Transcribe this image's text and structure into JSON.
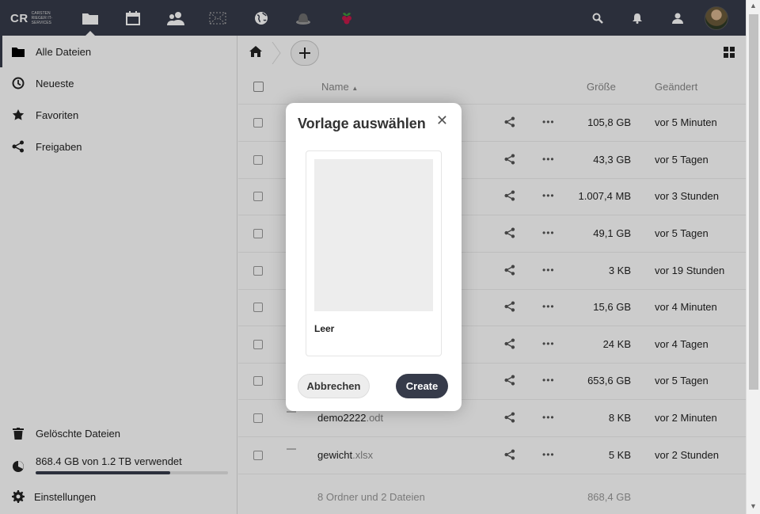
{
  "header": {
    "logo_text": "CR",
    "logo_subtitle": "Carsten Rieger IT-Services"
  },
  "sidebar": {
    "items": [
      {
        "label": "Alle Dateien",
        "icon": "folder-icon"
      },
      {
        "label": "Neueste",
        "icon": "clock-icon"
      },
      {
        "label": "Favoriten",
        "icon": "star-icon"
      },
      {
        "label": "Freigaben",
        "icon": "share-icon"
      }
    ],
    "deleted_label": "Gelöschte Dateien",
    "quota_label": "868.4 GB von 1.2 TB verwendet",
    "quota_fraction": 0.7,
    "settings_label": "Einstellungen"
  },
  "table": {
    "col_name": "Name",
    "col_size": "Größe",
    "col_modified": "Geändert",
    "rows": [
      {
        "name": "",
        "ext": "",
        "size": "105,8 GB",
        "modified": "vor 5 Minuten"
      },
      {
        "name": "",
        "ext": "",
        "size": "43,3 GB",
        "modified": "vor 5 Tagen"
      },
      {
        "name": "",
        "ext": "",
        "size": "1.007,4 MB",
        "modified": "vor 3 Stunden"
      },
      {
        "name": "",
        "ext": "",
        "size": "49,1 GB",
        "modified": "vor 5 Tagen"
      },
      {
        "name": "",
        "ext": "",
        "size": "3 KB",
        "modified": "vor 19 Stunden"
      },
      {
        "name": "",
        "ext": "",
        "size": "15,6 GB",
        "modified": "vor 4 Minuten"
      },
      {
        "name": "",
        "ext": "",
        "size": "24 KB",
        "modified": "vor 4 Tagen"
      },
      {
        "name": "",
        "ext": "",
        "size": "653,6 GB",
        "modified": "vor 5 Tagen"
      },
      {
        "name": "demo2222",
        "ext": ".odt",
        "size": "8 KB",
        "modified": "vor 2 Minuten"
      },
      {
        "name": "gewicht",
        "ext": ".xlsx",
        "size": "5 KB",
        "modified": "vor 2 Stunden"
      }
    ],
    "summary_text": "8 Ordner und 2 Dateien",
    "summary_size": "868,4 GB"
  },
  "dialog": {
    "title": "Vorlage auswählen",
    "close_glyph": "✕",
    "template_label": "Leer",
    "cancel_label": "Abbrechen",
    "create_label": "Create"
  },
  "colors": {
    "header_bg": "#363b4a",
    "accent": "#363b4a"
  }
}
